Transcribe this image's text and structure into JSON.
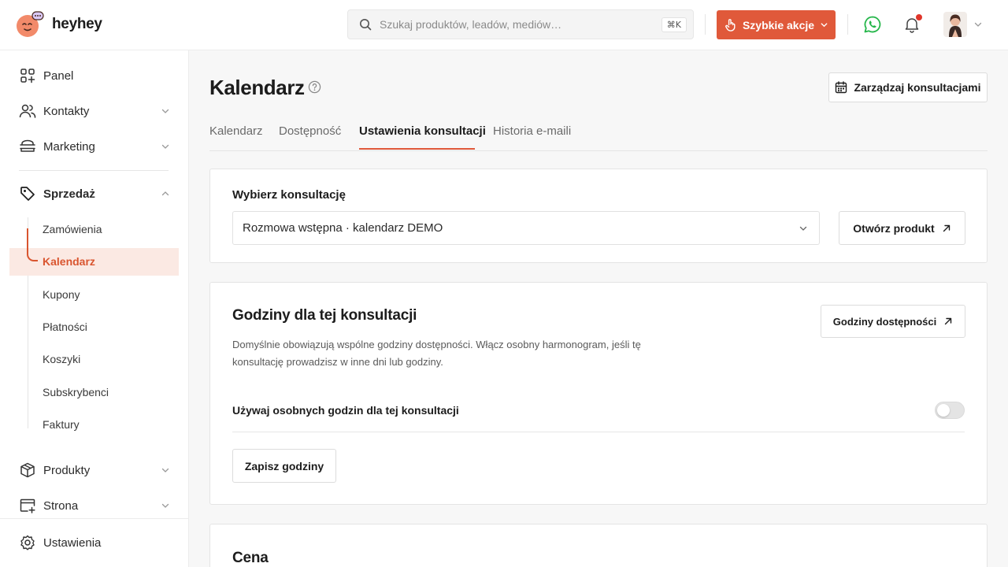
{
  "brand": {
    "name": "heyhey",
    "accent": "#e0593a"
  },
  "search": {
    "placeholder": "Szukaj produktów, leadów, mediów…",
    "shortcut": "⌘K"
  },
  "topbar": {
    "quick_actions": "Szybkie akcje"
  },
  "sidebar": {
    "panel": "Panel",
    "kontakty": "Kontakty",
    "marketing": "Marketing",
    "sprzedaz": "Sprzedaż",
    "sub": [
      "Zamówienia",
      "Kalendarz",
      "Kupony",
      "Płatności",
      "Koszyki",
      "Subskrybenci",
      "Faktury"
    ],
    "produkty": "Produkty",
    "strona": "Strona",
    "ustawienia": "Ustawienia"
  },
  "page": {
    "title": "Kalendarz",
    "manage_button": "Zarządzaj konsultacjami",
    "tabs": [
      "Kalendarz",
      "Dostępność",
      "Ustawienia konsultacji",
      "Historia e-maili"
    ]
  },
  "consult_select": {
    "label": "Wybierz konsultację",
    "value": "Rozmowa wstępna · kalendarz DEMO",
    "open_button": "Otwórz produkt"
  },
  "hours_card": {
    "title": "Godziny dla tej konsultacji",
    "button": "Godziny dostępności",
    "description": "Domyślnie obowiązują wspólne godziny dostępności. Włącz osobny harmonogram, jeśli tę konsultację prowadzisz w inne dni lub godziny.",
    "toggle_label": "Używaj osobnych godzin dla tej konsultacji",
    "save_button": "Zapisz godziny"
  },
  "price_card": {
    "title": "Cena"
  }
}
